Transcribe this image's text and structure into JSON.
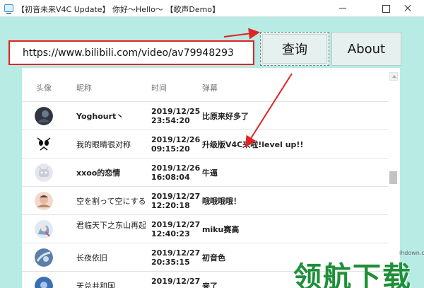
{
  "window": {
    "title": "【初音未来V4C Update】 你好～Hello～ 【歌声Demo】"
  },
  "toolbar": {
    "url_value": "https://www.bilibili.com/video/av79948293",
    "query_label": "查询",
    "about_label": "About"
  },
  "table": {
    "headers": {
      "avatar": "头像",
      "nickname": "昵称",
      "time": "时间",
      "message": "弹幕"
    },
    "rows": [
      {
        "nickname": "Yoghourt丶",
        "date": "2019/12/25",
        "clock": "23:54:20",
        "message": "比原来好多了"
      },
      {
        "nickname": "我的眼睛很对称",
        "date": "2019/12/26",
        "clock": "09:15:20",
        "message": "升级版V4C来啦!level up!!"
      },
      {
        "nickname": "xxoo的恋情",
        "date": "2019/12/26",
        "clock": "16:08:04",
        "message": "牛逼"
      },
      {
        "nickname": "空を割って空にする",
        "date": "2019/12/27",
        "clock": "12:20:18",
        "message": "哦哦哦哦！"
      },
      {
        "nickname": "君临天下之东山再起",
        "date": "2019/12/27",
        "clock": "12:40:23",
        "message": "miku赛高"
      },
      {
        "nickname": "长夜依旧",
        "date": "2019/12/27",
        "clock": "20:35:15",
        "message": "初音色"
      },
      {
        "nickname": "天总井和国",
        "date": "2019/12/27",
        "clock": "",
        "message": "来了"
      }
    ]
  },
  "watermark": {
    "site": "lhdown.com",
    "brand": "领航下载"
  },
  "colors": {
    "background": "#b8ebe4",
    "highlight_red": "#e02424",
    "watermark_green": "#1f8f3a"
  }
}
